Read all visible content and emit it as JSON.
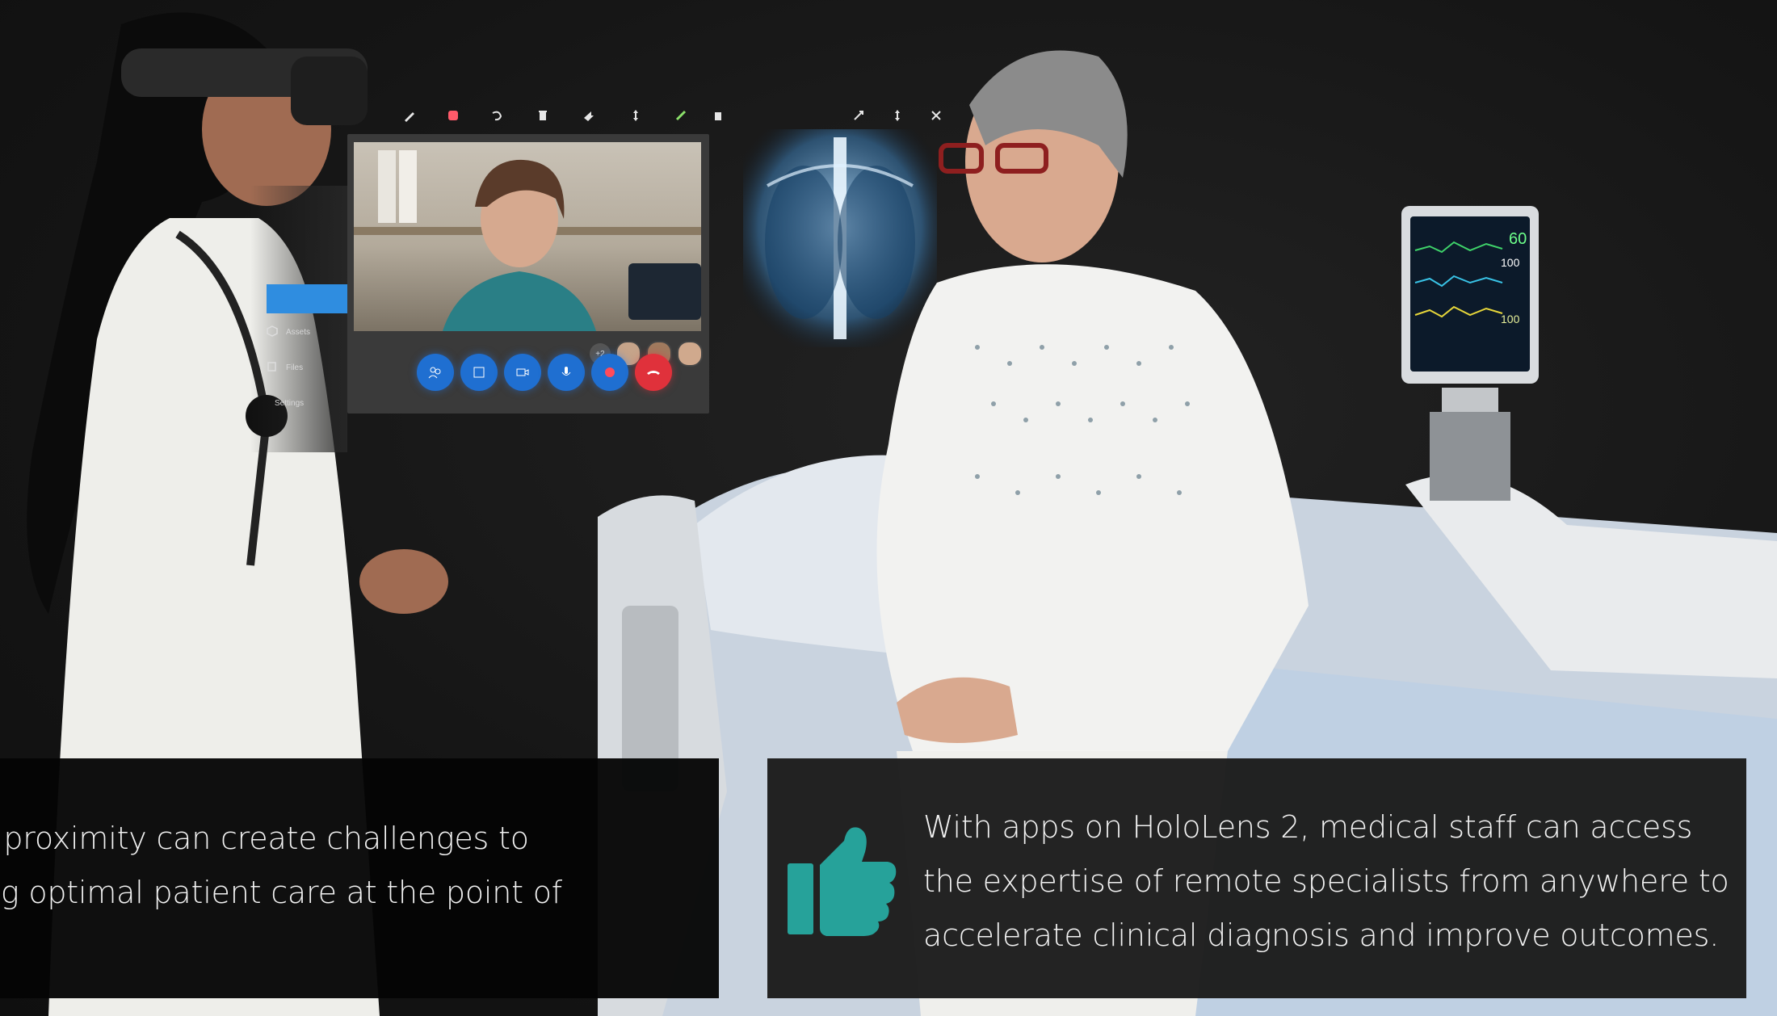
{
  "captions": {
    "left": "ical proximity can create challenges to\nering optimal patient care at the point of\n.",
    "right": "With apps on HoloLens 2, medical staff can access the expertise of remote specialists from anywhere to accelerate clinical diagnosis and improve outcomes."
  },
  "holo_app": {
    "sidebar": {
      "items": [
        {
          "label": "Assets",
          "icon": "cube-icon"
        },
        {
          "label": "Files",
          "icon": "files-icon"
        },
        {
          "label": "Settings",
          "icon": "settings-icon"
        }
      ]
    },
    "toolbar_icons": [
      "pen-icon",
      "record-icon",
      "undo-icon",
      "delete-icon",
      "arrow-icon",
      "move-icon",
      "pin-icon",
      "trash-icon"
    ],
    "window_icons": [
      "expand-icon",
      "move-icon",
      "close-icon"
    ],
    "participants_more": "+2",
    "call_controls": [
      "participants-icon",
      "screen-share-icon",
      "camera-icon",
      "microphone-icon",
      "record-icon",
      "end-call-icon"
    ]
  },
  "colors": {
    "accent_blue": "#2f8de0",
    "end_call_red": "#e0313b",
    "thumb_teal": "#26a29a",
    "panel_right_bg": "#1c1c1c",
    "panel_left_bg": "#050505"
  },
  "monitor": {
    "readings": [
      "60",
      "100",
      "100"
    ]
  }
}
